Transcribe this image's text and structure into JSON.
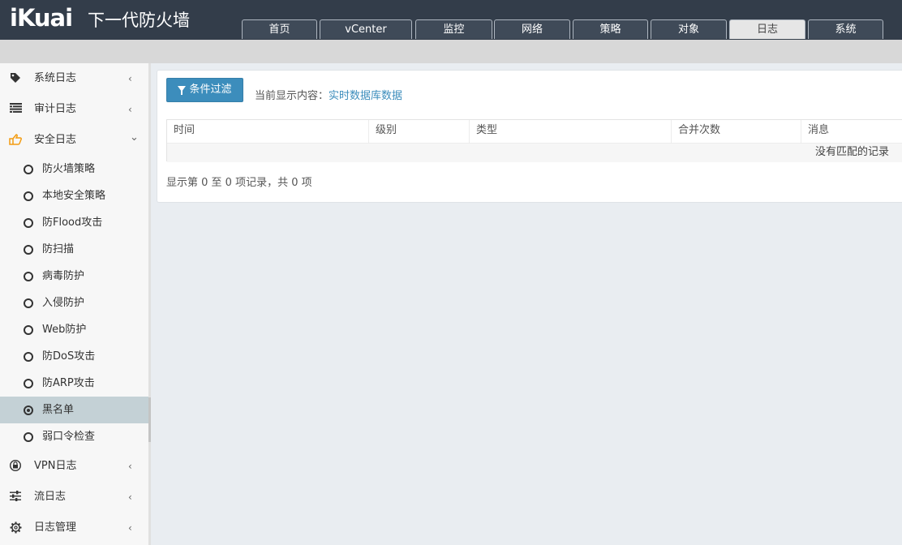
{
  "header": {
    "logo": "iKuai",
    "product": "下一代防火墙",
    "tabs": [
      "首页",
      "vCenter",
      "监控",
      "网络",
      "策略",
      "对象",
      "日志",
      "系统"
    ],
    "active_tab": "日志"
  },
  "sidebar": {
    "groups": [
      {
        "label": "系统日志",
        "icon": "tag-icon",
        "chevron": "‹"
      },
      {
        "label": "审计日志",
        "icon": "list-icon",
        "chevron": "‹"
      },
      {
        "label": "安全日志",
        "icon": "hand-pointer-icon",
        "chevron": "⌄",
        "expanded": true
      }
    ],
    "security_items": [
      "防火墙策略",
      "本地安全策略",
      "防Flood攻击",
      "防扫描",
      "病毒防护",
      "入侵防护",
      "Web防护",
      "防DoS攻击",
      "防ARP攻击",
      "黑名单",
      "弱口令检查"
    ],
    "active_item": "黑名单",
    "bottom_groups": [
      {
        "label": "VPN日志",
        "icon": "lock-icon",
        "chevron": "‹"
      },
      {
        "label": "流日志",
        "icon": "sliders-icon",
        "chevron": "‹"
      },
      {
        "label": "日志管理",
        "icon": "gear-icon",
        "chevron": "‹"
      }
    ],
    "colors": {
      "accent": "#f39c12",
      "active_bg": "#c4d1d6"
    }
  },
  "main": {
    "filter_button": "条件过滤",
    "current_label": "当前显示内容：",
    "current_value": "实时数据库数据",
    "columns": [
      "时间",
      "级别",
      "类型",
      "合并次数",
      "消息"
    ],
    "empty_text": "没有匹配的记录",
    "summary": "显示第 0 至 0 项记录，共 0 项",
    "colors": {
      "primary": "#3c8dbc"
    }
  }
}
